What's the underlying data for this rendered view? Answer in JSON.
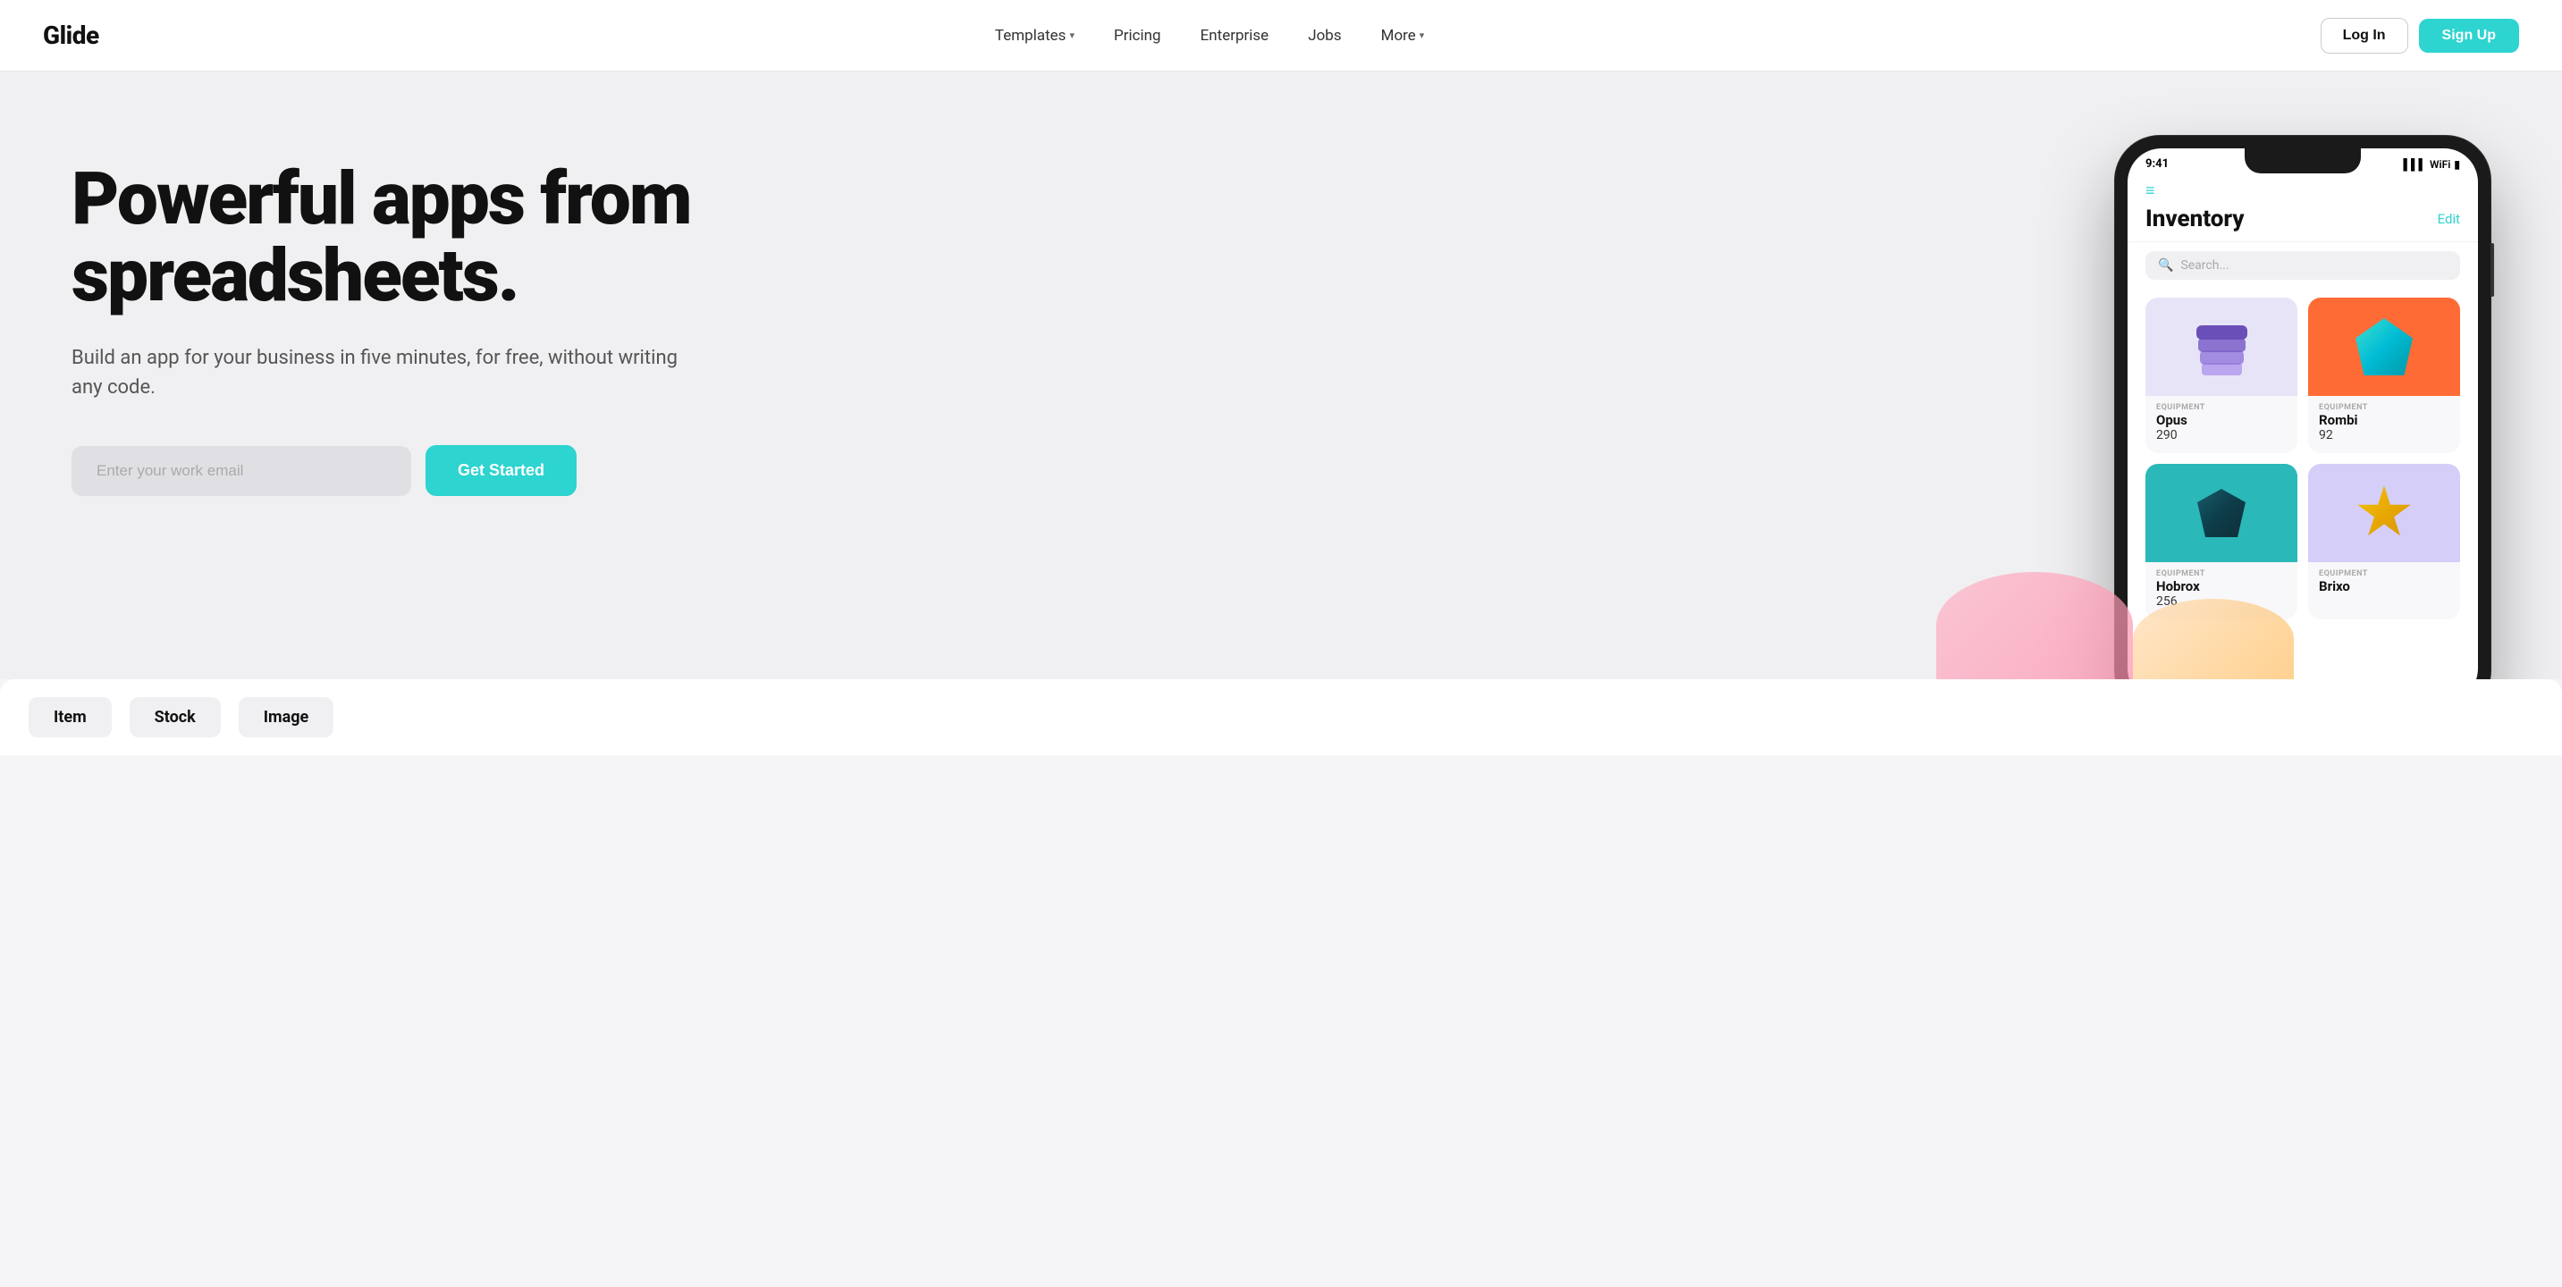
{
  "brand": {
    "logo": "Glide"
  },
  "nav": {
    "links": [
      {
        "label": "Templates",
        "hasDropdown": true
      },
      {
        "label": "Pricing",
        "hasDropdown": false
      },
      {
        "label": "Enterprise",
        "hasDropdown": false
      },
      {
        "label": "Jobs",
        "hasDropdown": false
      },
      {
        "label": "More",
        "hasDropdown": true
      }
    ],
    "login_label": "Log In",
    "signup_label": "Sign Up"
  },
  "hero": {
    "title": "Powerful apps from spreadsheets.",
    "subtitle": "Build an app for your business in five minutes, for free, without writing any code.",
    "email_placeholder": "Enter your work email",
    "cta_label": "Get Started"
  },
  "phone": {
    "time": "9:41",
    "title": "Inventory",
    "edit_label": "Edit",
    "search_placeholder": "Search...",
    "items": [
      {
        "category": "EQUIPMENT",
        "name": "Opus",
        "stock": "290",
        "color": "purple"
      },
      {
        "category": "EQUIPMENT",
        "name": "Rombi",
        "stock": "92",
        "color": "orange"
      },
      {
        "category": "EQUIPMENT",
        "name": "Hobrox",
        "stock": "256",
        "color": "teal"
      },
      {
        "category": "EQUIPMENT",
        "name": "Brixo",
        "stock": "",
        "color": "lavender"
      }
    ]
  },
  "table": {
    "columns": [
      "Item",
      "Stock",
      "Image"
    ]
  },
  "colors": {
    "accent": "#2dd4d0",
    "text_dark": "#111111",
    "text_muted": "#555555",
    "bg_hero": "#f0f0f2"
  }
}
